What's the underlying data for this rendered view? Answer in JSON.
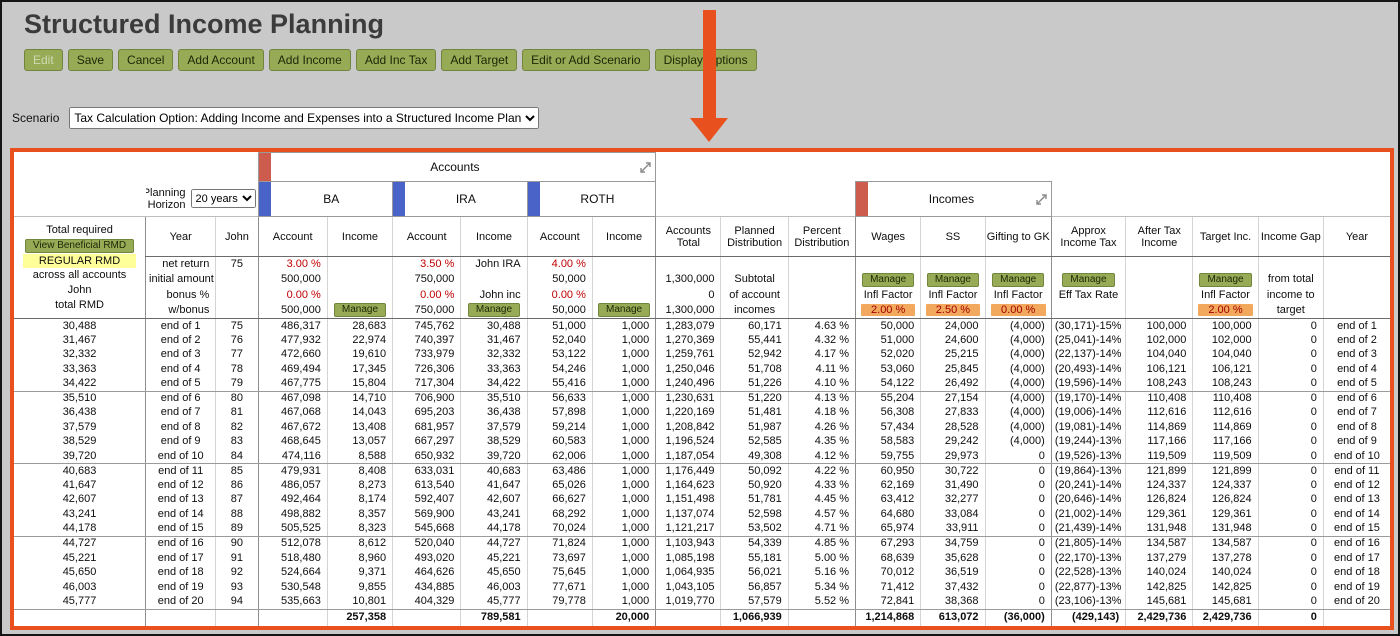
{
  "page": {
    "title": "Structured Income Planning",
    "scenario_label": "Scenario",
    "scenario_value": "Tax Calculation Option: Adding Income and Expenses into a Structured Income Plan"
  },
  "toolbar": {
    "buttons": [
      "Edit",
      "Save",
      "Cancel",
      "Add Account",
      "Add Income",
      "Add Inc Tax",
      "Add Target",
      "Edit or Add Scenario",
      "Display Options"
    ]
  },
  "colors": {
    "accent_orange": "#e8511d",
    "button_green": "#97ab56",
    "tab_red": "#cd5c4e",
    "tab_blue": "#4a63c8",
    "rmd_yellow": "#ffff99",
    "infl_orange": "#f2a95e"
  },
  "planner": {
    "groups": {
      "accounts": "Accounts",
      "incomes": "Incomes",
      "ba": "BA",
      "ira": "IRA",
      "roth": "ROTH"
    },
    "planning_horizon": {
      "label_line1": "Planning",
      "label_line2": "Horizon",
      "value": "20 years"
    },
    "left_panel": {
      "line1": "Total required",
      "rmd_button": "View Beneficial RMD",
      "regular_rmd": "REGULAR RMD",
      "line3": "across all accounts",
      "line4": "John",
      "line5": "total RMD"
    },
    "columns": {
      "year": "Year",
      "age": "John",
      "account": "Account",
      "income": "Income",
      "accounts_total": "Accounts Total",
      "planned_distribution": "Planned Distribution",
      "percent_distribution": "Percent Distribution",
      "wages": "Wages",
      "ss": "SS",
      "gifting": "Gifting to GK",
      "approx_income_tax": "Approx Income Tax",
      "after_tax_income": "After Tax Income",
      "target_inc": "Target Inc.",
      "income_gap": "Income Gap",
      "year_end": "Year"
    },
    "setup": {
      "manage_label": "Manage",
      "net_return": {
        "label": "net return",
        "age": "75",
        "ba": "3.00 %",
        "ira": "3.50 %",
        "ira_owner": "John IRA",
        "roth": "4.00 %"
      },
      "initial_amount": {
        "label": "initial amount",
        "ba": "500,000",
        "ira": "750,000",
        "roth": "50,000",
        "accounts_total": "1,300,000",
        "planned": "Subtotal",
        "gap": "from total"
      },
      "bonus": {
        "label": "bonus %",
        "ba": "0.00 %",
        "ira": "0.00 %",
        "ira_owner": "John inc",
        "roth": "0.00 %",
        "accounts_total": "0",
        "planned": "of account",
        "wages": "Infl Factor",
        "ss": "Infl Factor",
        "gifting": "Infl Factor",
        "approx": "Eff Tax Rate",
        "target": "Infl Factor",
        "gap": "income to"
      },
      "w_bonus": {
        "label": "w/bonus",
        "ba": "500,000",
        "ira": "750,000",
        "roth": "50,000",
        "accounts_total": "1,300,000",
        "planned": "incomes",
        "wages": "2.00 %",
        "ss": "2.50 %",
        "gifting": "0.00 %",
        "target": "2.00 %",
        "gap": "target"
      }
    },
    "table": {
      "rows": [
        [
          "30,488",
          "end of 1",
          "75",
          "486,317",
          "28,683",
          "745,762",
          "30,488",
          "51,000",
          "1,000",
          "1,283,079",
          "60,171",
          "4.63 %",
          "50,000",
          "24,000",
          "(4,000)",
          "(30,171)-15%",
          "100,000",
          "100,000",
          "0",
          "end of 1"
        ],
        [
          "31,467",
          "end of 2",
          "76",
          "477,932",
          "22,974",
          "740,397",
          "31,467",
          "52,040",
          "1,000",
          "1,270,369",
          "55,441",
          "4.32 %",
          "51,000",
          "24,600",
          "(4,000)",
          "(25,041)-14%",
          "102,000",
          "102,000",
          "0",
          "end of 2"
        ],
        [
          "32,332",
          "end of 3",
          "77",
          "472,660",
          "19,610",
          "733,979",
          "32,332",
          "53,122",
          "1,000",
          "1,259,761",
          "52,942",
          "4.17 %",
          "52,020",
          "25,215",
          "(4,000)",
          "(22,137)-14%",
          "104,040",
          "104,040",
          "0",
          "end of 3"
        ],
        [
          "33,363",
          "end of 4",
          "78",
          "469,494",
          "17,345",
          "726,306",
          "33,363",
          "54,246",
          "1,000",
          "1,250,046",
          "51,708",
          "4.11 %",
          "53,060",
          "25,845",
          "(4,000)",
          "(20,493)-14%",
          "106,121",
          "106,121",
          "0",
          "end of 4"
        ],
        [
          "34,422",
          "end of 5",
          "79",
          "467,775",
          "15,804",
          "717,304",
          "34,422",
          "55,416",
          "1,000",
          "1,240,496",
          "51,226",
          "4.10 %",
          "54,122",
          "26,492",
          "(4,000)",
          "(19,596)-14%",
          "108,243",
          "108,243",
          "0",
          "end of 5"
        ],
        [
          "35,510",
          "end of 6",
          "80",
          "467,098",
          "14,710",
          "706,900",
          "35,510",
          "56,633",
          "1,000",
          "1,230,631",
          "51,220",
          "4.13 %",
          "55,204",
          "27,154",
          "(4,000)",
          "(19,170)-14%",
          "110,408",
          "110,408",
          "0",
          "end of 6"
        ],
        [
          "36,438",
          "end of 7",
          "81",
          "467,068",
          "14,043",
          "695,203",
          "36,438",
          "57,898",
          "1,000",
          "1,220,169",
          "51,481",
          "4.18 %",
          "56,308",
          "27,833",
          "(4,000)",
          "(19,006)-14%",
          "112,616",
          "112,616",
          "0",
          "end of 7"
        ],
        [
          "37,579",
          "end of 8",
          "82",
          "467,672",
          "13,408",
          "681,957",
          "37,579",
          "59,214",
          "1,000",
          "1,208,842",
          "51,987",
          "4.26 %",
          "57,434",
          "28,528",
          "(4,000)",
          "(19,081)-14%",
          "114,869",
          "114,869",
          "0",
          "end of 8"
        ],
        [
          "38,529",
          "end of 9",
          "83",
          "468,645",
          "13,057",
          "667,297",
          "38,529",
          "60,583",
          "1,000",
          "1,196,524",
          "52,585",
          "4.35 %",
          "58,583",
          "29,242",
          "(4,000)",
          "(19,244)-13%",
          "117,166",
          "117,166",
          "0",
          "end of 9"
        ],
        [
          "39,720",
          "end of 10",
          "84",
          "474,116",
          "8,588",
          "650,932",
          "39,720",
          "62,006",
          "1,000",
          "1,187,054",
          "49,308",
          "4.12 %",
          "59,755",
          "29,973",
          "0",
          "(19,526)-13%",
          "119,509",
          "119,509",
          "0",
          "end of 10"
        ],
        [
          "40,683",
          "end of 11",
          "85",
          "479,931",
          "8,408",
          "633,031",
          "40,683",
          "63,486",
          "1,000",
          "1,176,449",
          "50,092",
          "4.22 %",
          "60,950",
          "30,722",
          "0",
          "(19,864)-13%",
          "121,899",
          "121,899",
          "0",
          "end of 11"
        ],
        [
          "41,647",
          "end of 12",
          "86",
          "486,057",
          "8,273",
          "613,540",
          "41,647",
          "65,026",
          "1,000",
          "1,164,623",
          "50,920",
          "4.33 %",
          "62,169",
          "31,490",
          "0",
          "(20,241)-14%",
          "124,337",
          "124,337",
          "0",
          "end of 12"
        ],
        [
          "42,607",
          "end of 13",
          "87",
          "492,464",
          "8,174",
          "592,407",
          "42,607",
          "66,627",
          "1,000",
          "1,151,498",
          "51,781",
          "4.45 %",
          "63,412",
          "32,277",
          "0",
          "(20,646)-14%",
          "126,824",
          "126,824",
          "0",
          "end of 13"
        ],
        [
          "43,241",
          "end of 14",
          "88",
          "498,882",
          "8,357",
          "569,900",
          "43,241",
          "68,292",
          "1,000",
          "1,137,074",
          "52,598",
          "4.57 %",
          "64,680",
          "33,084",
          "0",
          "(21,002)-14%",
          "129,361",
          "129,361",
          "0",
          "end of 14"
        ],
        [
          "44,178",
          "end of 15",
          "89",
          "505,525",
          "8,323",
          "545,668",
          "44,178",
          "70,024",
          "1,000",
          "1,121,217",
          "53,502",
          "4.71 %",
          "65,974",
          "33,911",
          "0",
          "(21,439)-14%",
          "131,948",
          "131,948",
          "0",
          "end of 15"
        ],
        [
          "44,727",
          "end of 16",
          "90",
          "512,078",
          "8,612",
          "520,040",
          "44,727",
          "71,824",
          "1,000",
          "1,103,943",
          "54,339",
          "4.85 %",
          "67,293",
          "34,759",
          "0",
          "(21,805)-14%",
          "134,587",
          "134,587",
          "0",
          "end of 16"
        ],
        [
          "45,221",
          "end of 17",
          "91",
          "518,480",
          "8,960",
          "493,020",
          "45,221",
          "73,697",
          "1,000",
          "1,085,198",
          "55,181",
          "5.00 %",
          "68,639",
          "35,628",
          "0",
          "(22,170)-13%",
          "137,279",
          "137,278",
          "0",
          "end of 17"
        ],
        [
          "45,650",
          "end of 18",
          "92",
          "524,664",
          "9,371",
          "464,626",
          "45,650",
          "75,645",
          "1,000",
          "1,064,935",
          "56,021",
          "5.16 %",
          "70,012",
          "36,519",
          "0",
          "(22,528)-13%",
          "140,024",
          "140,024",
          "0",
          "end of 18"
        ],
        [
          "46,003",
          "end of 19",
          "93",
          "530,548",
          "9,855",
          "434,885",
          "46,003",
          "77,671",
          "1,000",
          "1,043,105",
          "56,857",
          "5.34 %",
          "71,412",
          "37,432",
          "0",
          "(22,877)-13%",
          "142,825",
          "142,825",
          "0",
          "end of 19"
        ],
        [
          "45,777",
          "end of 20",
          "94",
          "535,663",
          "10,801",
          "404,329",
          "45,777",
          "79,778",
          "1,000",
          "1,019,770",
          "57,579",
          "5.52 %",
          "72,841",
          "38,368",
          "0",
          "(23,106)-13%",
          "145,681",
          "145,681",
          "0",
          "end of 20"
        ]
      ],
      "footer": [
        "",
        "",
        "",
        "",
        "257,358",
        "",
        "789,581",
        "",
        "20,000",
        "",
        "1,066,939",
        "",
        "1,214,868",
        "613,072",
        "(36,000)",
        "(429,143)",
        "2,429,736",
        "2,429,736",
        "0",
        ""
      ]
    }
  }
}
